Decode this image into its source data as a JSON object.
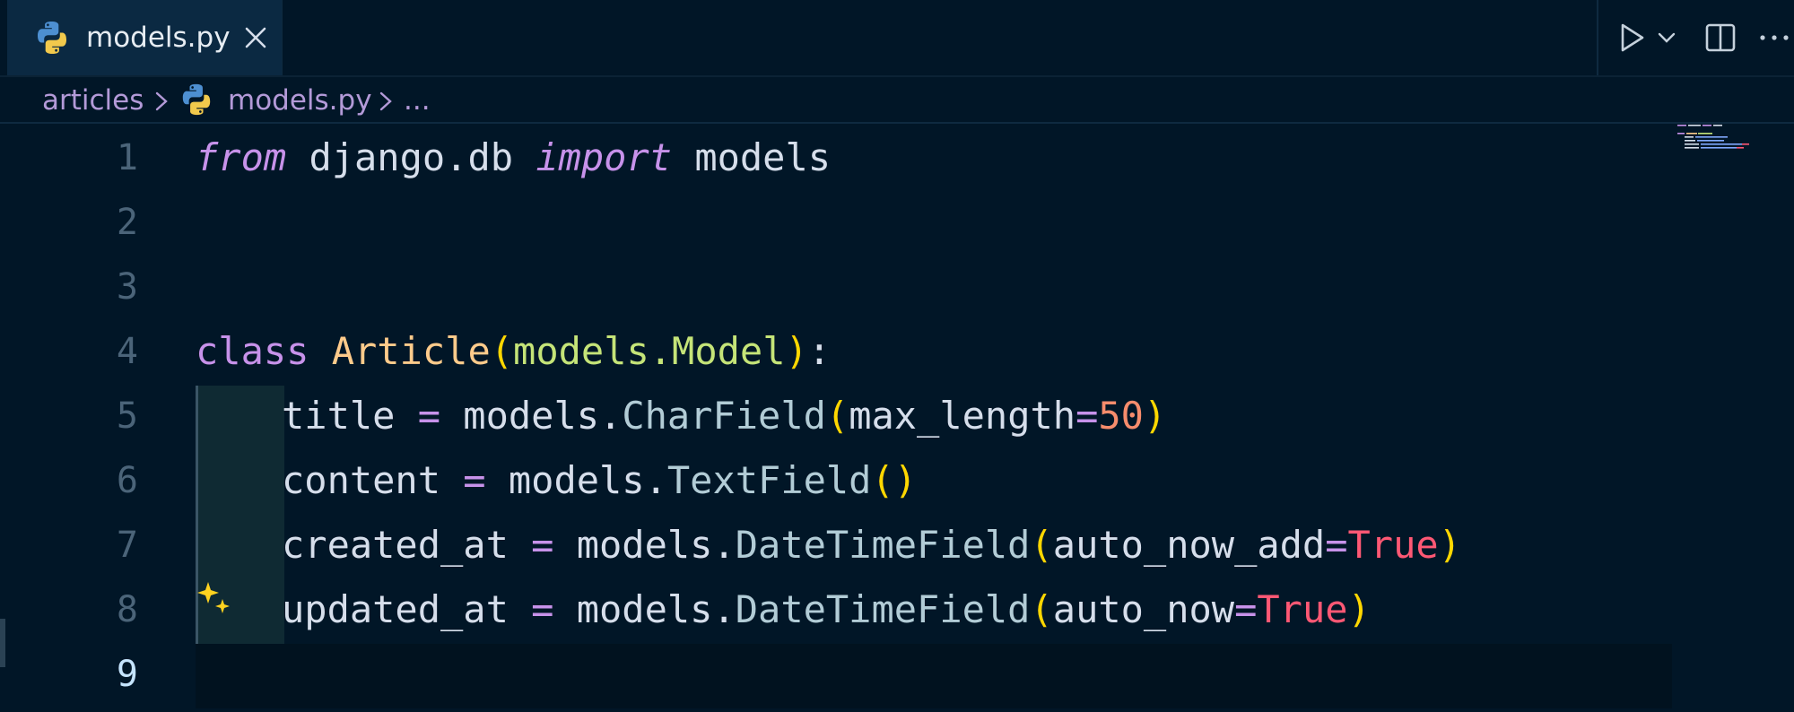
{
  "tab": {
    "filename": "models.py",
    "icon": "python-icon",
    "close_icon": "close-icon"
  },
  "actions": {
    "run_icon": "play-icon",
    "run_menu_icon": "chevron-down-icon",
    "split_icon": "split-editor-icon",
    "more_icon": "more-icon"
  },
  "breadcrumb": {
    "folder": "articles",
    "file": "models.py",
    "symbol": "..."
  },
  "editor": {
    "line_numbers": [
      "1",
      "2",
      "3",
      "4",
      "5",
      "6",
      "7",
      "8",
      "9"
    ],
    "active_line": "9",
    "lines": {
      "l1": {
        "from": "from",
        "module": " django.db ",
        "import": "import",
        "name": " models"
      },
      "l4": {
        "class": "class",
        "sp": " ",
        "name": "Article",
        "open": "(",
        "base": "models.Model",
        "close": ")",
        "colon": ":"
      },
      "l5": {
        "var": "title",
        "eq": " = ",
        "obj": "models.",
        "call": "CharField",
        "open": "(",
        "kw": "max_length",
        "assign": "=",
        "val": "50",
        "close": ")"
      },
      "l6": {
        "var": "content",
        "eq": " = ",
        "obj": "models.",
        "call": "TextField",
        "parens": "()"
      },
      "l7": {
        "var": "created_at",
        "eq": " = ",
        "obj": "models.",
        "call": "DateTimeField",
        "open": "(",
        "kw": "auto_now_add",
        "assign": "=",
        "val": "True",
        "close": ")"
      },
      "l8": {
        "var": "updated_at",
        "eq": " = ",
        "obj": "models.",
        "call": "DateTimeField",
        "open": "(",
        "kw": "auto_now",
        "assign": "=",
        "val": "True",
        "close": ")"
      }
    },
    "sparkle_icon": "sparkle-icon"
  },
  "colors": {
    "background": "#011627",
    "keyword": "#c792ea",
    "class_name": "#ffcb8b",
    "base_class": "#c5e478",
    "paren": "#ffd700",
    "number": "#f78c6c",
    "boolean": "#ff5874",
    "text": "#d6deeb"
  }
}
